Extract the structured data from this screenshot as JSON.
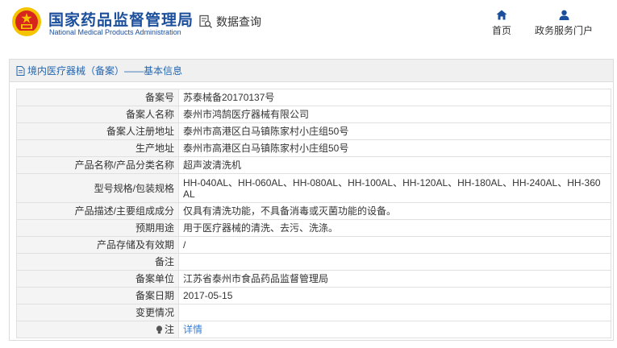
{
  "header": {
    "brand_cn": "国家药品监督管理局",
    "brand_en": "National Medical Products Administration",
    "query_label": "数据查询",
    "nav": [
      {
        "label": "首页",
        "icon": "home-icon"
      },
      {
        "label": "政务服务门户",
        "icon": "user-icon"
      }
    ]
  },
  "panel": {
    "title": "境内医疗器械（备案）——基本信息",
    "title_icon": "document-icon"
  },
  "rows": [
    {
      "label": "备案号",
      "value": "苏泰械备20170137号"
    },
    {
      "label": "备案人名称",
      "value": "泰州市鸿鹄医疗器械有限公司"
    },
    {
      "label": "备案人注册地址",
      "value": "泰州市高港区白马镇陈家村小庄组50号"
    },
    {
      "label": "生产地址",
      "value": "泰州市高港区白马镇陈家村小庄组50号"
    },
    {
      "label": "产品名称/产品分类名称",
      "value": "超声波清洗机"
    },
    {
      "label": "型号规格/包装规格",
      "value": "HH-040AL、HH-060AL、HH-080AL、HH-100AL、HH-120AL、HH-180AL、HH-240AL、HH-360AL"
    },
    {
      "label": "产品描述/主要组成成分",
      "value": "仅具有清洗功能，不具备消毒或灭菌功能的设备。"
    },
    {
      "label": "预期用途",
      "value": "用于医疗器械的清洗、去污、洗涤。"
    },
    {
      "label": "产品存储及有效期",
      "value": "/"
    },
    {
      "label": "备注",
      "value": ""
    },
    {
      "label": "备案单位",
      "value": "江苏省泰州市食品药品监督管理局"
    },
    {
      "label": "备案日期",
      "value": "2017-05-15"
    },
    {
      "label": "变更情况",
      "value": ""
    },
    {
      "label": "注",
      "value": "详情"
    }
  ],
  "colors": {
    "brand_blue": "#1b4f9c",
    "link_blue": "#3a7fd5",
    "label_bg": "#f4f4f4",
    "emblem_red": "#d7261e",
    "emblem_gold": "#f5c400"
  }
}
